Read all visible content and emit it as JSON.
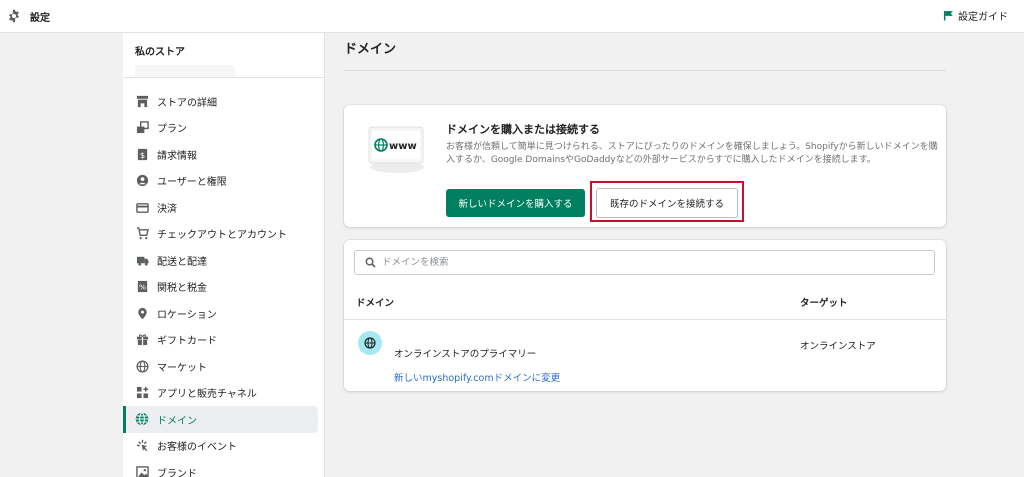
{
  "topbar": {
    "title": "設定",
    "guide_label": "設定ガイド"
  },
  "sidebar": {
    "store_name": "私のストア",
    "items": [
      {
        "label": "ストアの詳細",
        "icon": "store-icon"
      },
      {
        "label": "プラン",
        "icon": "plan-icon"
      },
      {
        "label": "請求情報",
        "icon": "billing-icon"
      },
      {
        "label": "ユーザーと権限",
        "icon": "user-icon"
      },
      {
        "label": "決済",
        "icon": "payment-icon"
      },
      {
        "label": "チェックアウトとアカウント",
        "icon": "cart-icon"
      },
      {
        "label": "配送と配達",
        "icon": "truck-icon"
      },
      {
        "label": "関税と税金",
        "icon": "tax-icon"
      },
      {
        "label": "ロケーション",
        "icon": "location-icon"
      },
      {
        "label": "ギフトカード",
        "icon": "gift-icon"
      },
      {
        "label": "マーケット",
        "icon": "globe-icon"
      },
      {
        "label": "アプリと販売チャネル",
        "icon": "apps-icon"
      },
      {
        "label": "ドメイン",
        "icon": "domain-globe-icon",
        "active": true
      },
      {
        "label": "お客様のイベント",
        "icon": "events-icon"
      },
      {
        "label": "ブランド",
        "icon": "brand-icon"
      }
    ]
  },
  "main": {
    "title": "ドメイン",
    "promo": {
      "illustration_text": "www",
      "heading": "ドメインを購入または接続する",
      "description": "お客様が信頼して簡単に見つけられる、ストアにぴったりのドメインを確保しましょう。Shopifyから新しいドメインを購入するか、Google DomainsやGoDaddyなどの外部サービスからすでに購入したドメインを接続します。",
      "buy_button": "新しいドメインを購入する",
      "connect_button": "既存のドメインを接続する"
    },
    "domains": {
      "search_placeholder": "ドメインを検索",
      "col_domain": "ドメイン",
      "col_target": "ターゲット",
      "rows": [
        {
          "name": "オンラインストアのプライマリー",
          "link": "新しいmyshopify.comドメインに変更",
          "target": "オンラインストア"
        }
      ]
    }
  },
  "colors": {
    "primary": "#008060",
    "link": "#2c6ecb",
    "highlight": "#c8102e",
    "domain_badge": "#a4e8f2"
  }
}
